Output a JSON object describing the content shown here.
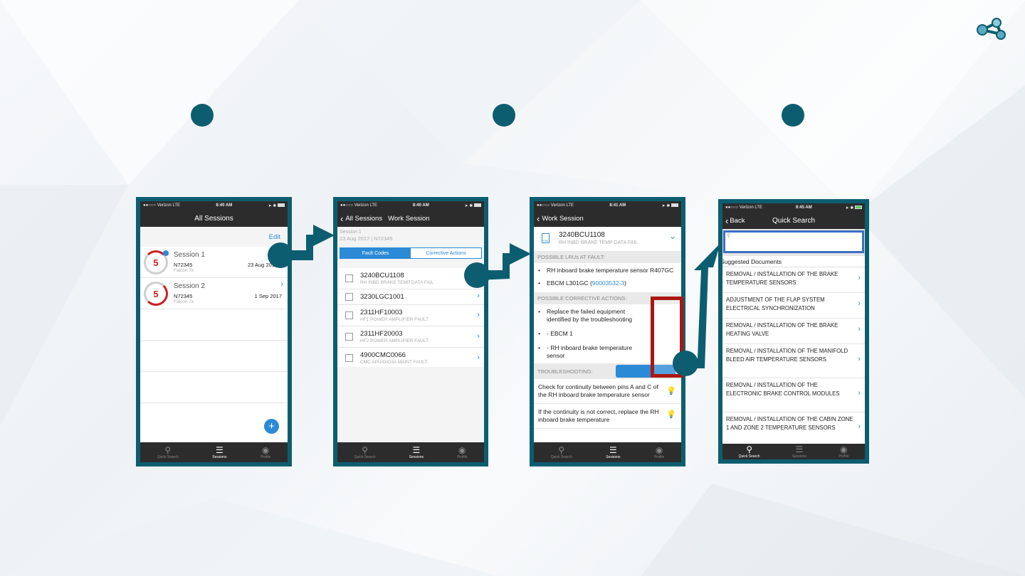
{
  "status": {
    "carrier": "●●○○○ Verizon  LTE",
    "times": [
      "8:40 AM",
      "8:40 AM",
      "8:41 AM",
      "9:45 AM"
    ]
  },
  "tabs": [
    "Quick Search",
    "Sessions",
    "Profile"
  ],
  "screen1": {
    "title": "All Sessions",
    "edit": "Edit",
    "sessions": [
      {
        "count": "5",
        "name": "Session 1",
        "tail": "N72345",
        "date": "23 Aug 2017",
        "model": "Falcon 7x"
      },
      {
        "count": "5",
        "name": "Session 2",
        "tail": "N72345",
        "date": "1 Sep 2017",
        "model": "Falcon 7x"
      }
    ],
    "add": "+"
  },
  "screen2": {
    "back": "All Sessions",
    "title": "Work Session",
    "session_name": "Session 1",
    "session_meta": "23 Aug 2017  |  N72345",
    "seg_fault": "Fault Codes",
    "seg_corrective": "Corrective Actions",
    "faults": [
      {
        "code": "3240BCU1108",
        "desc": "RH INBD BRAKE TEMP DATA FAIL"
      },
      {
        "code": "3230LGC1001",
        "desc": ""
      },
      {
        "code": "2311HF10003",
        "desc": "HF1 POWER AMPLIFIER FAULT"
      },
      {
        "code": "2311HF20003",
        "desc": "HF2 POWER AMPLIFIER FAULT"
      },
      {
        "code": "4900CMC0066",
        "desc": "CMC APU/GIO3A MAINT FAULT"
      }
    ]
  },
  "screen3": {
    "back": "Work Session",
    "code": "3240BCU1108",
    "desc": "RH INBD BRAKE TEMP DATA FAIL",
    "lru_header": "POSSIBLE LRUs AT FAULT:",
    "lru1": "RH inboard brake temperature sensor R407GC",
    "lru2_prefix": "EBCM L301GC (",
    "lru2_link": "90003532-3",
    "lru2_suffix": ")",
    "actions_header": "POSSIBLE CORRECTIVE ACTIONS:",
    "actions": [
      "Replace the failed equipment identified by the troubleshooting",
      "- EBCM 1",
      "- RH inboard brake temperature sensor"
    ],
    "ts_header": "TROUBLESHOOTING:",
    "ts_steps": [
      "Check for continuity between pins A and C of the RH inboard brake temperature sensor",
      "If the continuity is not correct, replace the RH inboard brake temperature"
    ]
  },
  "screen4": {
    "back": "Back",
    "title": "Quick Search",
    "search_placeholder": "",
    "suggested": "Suggested Documents",
    "docs": [
      "REMOVAL / INSTALLATION OF THE BRAKE TEMPERATURE SENSORS",
      "ADJUSTMENT OF THE FLAP SYSTEM ELECTRICAL SYNCHRONIZATION",
      "REMOVAL / INSTALLATION OF THE BRAKE HEATING VALVE",
      "REMOVAL / INSTALLATION OF THE MANIFOLD BLEED AIR TEMPERATURE SENSORS",
      "REMOVAL / INSTALLATION OF THE ELECTRONIC BRAKE CONTROL MODULES",
      "REMOVAL / INSTALLATION OF THE CABIN ZONE 1 AND ZONE 2 TEMPERATURE SENSORS"
    ]
  },
  "colors": {
    "frame": "#0d5d70",
    "highlight": "#aa1712",
    "accent": "#2a8ad6"
  }
}
